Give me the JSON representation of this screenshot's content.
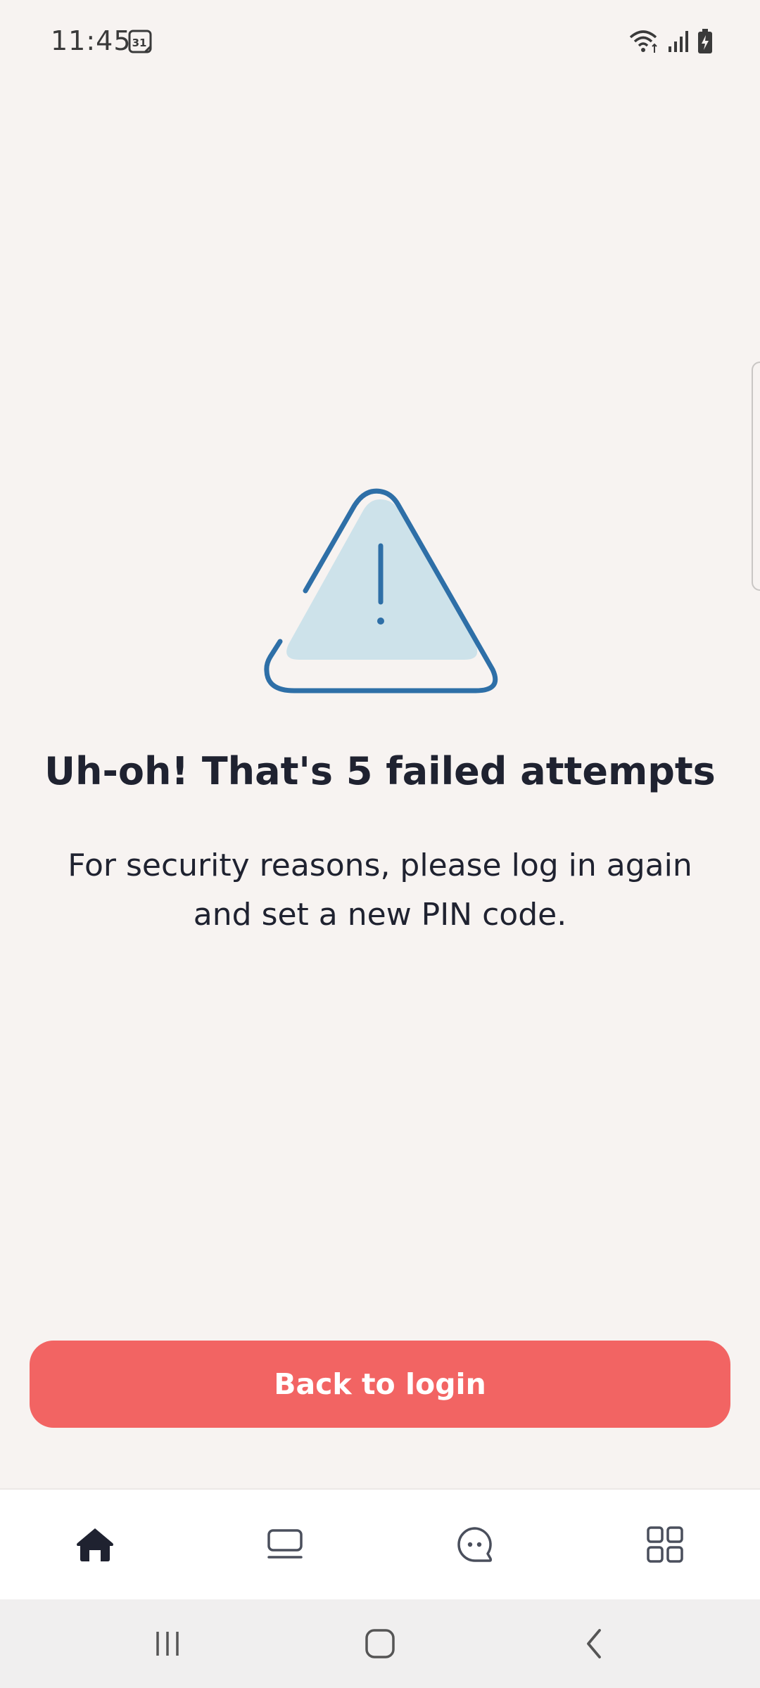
{
  "status_bar": {
    "time": "11:45",
    "calendar_day": "31"
  },
  "content": {
    "headline": "Uh-oh! That's 5 failed attempts",
    "message": "For security reasons, please log in again and set a new PIN code."
  },
  "actions": {
    "back_to_login_label": "Back to login"
  },
  "tab_bar": {
    "items": [
      {
        "icon": "home-icon",
        "active": true
      },
      {
        "icon": "card-icon",
        "active": false
      },
      {
        "icon": "chat-icon",
        "active": false
      },
      {
        "icon": "grid-menu-icon",
        "active": false
      }
    ]
  },
  "colors": {
    "background": "#f7f3f1",
    "accent": "#f26463",
    "icon_blue": "#2e6fa7",
    "icon_fill": "#cde2ea",
    "text": "#1f2230"
  }
}
